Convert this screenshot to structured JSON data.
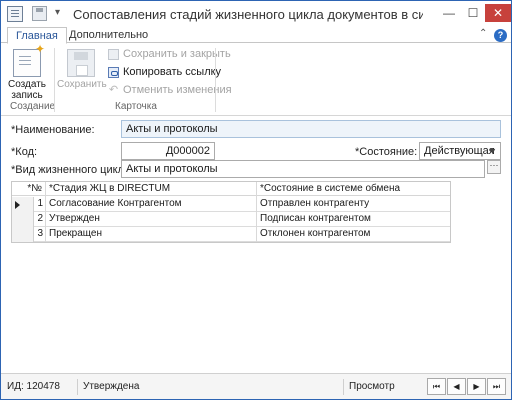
{
  "window": {
    "title": "Сопоставления стадий жизненного цикла документов в система...",
    "minimize": "—",
    "maximize": "☐",
    "close": "✕"
  },
  "ribbon": {
    "tabs": [
      "Главная",
      "Дополнительно"
    ],
    "collapse": "⌃",
    "help": "?",
    "groups": {
      "create": {
        "label": "Создание",
        "button": "Создать запись"
      },
      "card": {
        "label": "Карточка",
        "save": "Сохранить",
        "save_close": "Сохранить и закрыть",
        "copy_link": "Копировать ссылку",
        "cancel_changes": "Отменить изменения"
      }
    }
  },
  "form": {
    "name_label": "*Наименование:",
    "name_value": "Акты и протоколы",
    "code_label": "*Код:",
    "code_value": "Д000002",
    "state_label": "*Состояние:",
    "state_value": "Действующая",
    "lifecycle_label": "*Вид жизненного цикла:",
    "lifecycle_value": "Акты и протоколы",
    "ellipsis": "···"
  },
  "grid": {
    "columns": [
      "*№",
      "*Стадия ЖЦ в DIRECTUM",
      "*Состояние в системе обмена"
    ],
    "rows": [
      {
        "num": "1",
        "stage": "Согласование Контрагентом",
        "state": "Отправлен контрагенту"
      },
      {
        "num": "2",
        "stage": "Утвержден",
        "state": "Подписан контрагентом"
      },
      {
        "num": "3",
        "stage": "Прекращен",
        "state": "Отклонен контрагентом"
      }
    ]
  },
  "status": {
    "id": "ИД: 120478",
    "state": "Утверждена",
    "mode": "Просмотр",
    "nav": [
      "⏮",
      "◀",
      "▶",
      "⏭"
    ]
  }
}
